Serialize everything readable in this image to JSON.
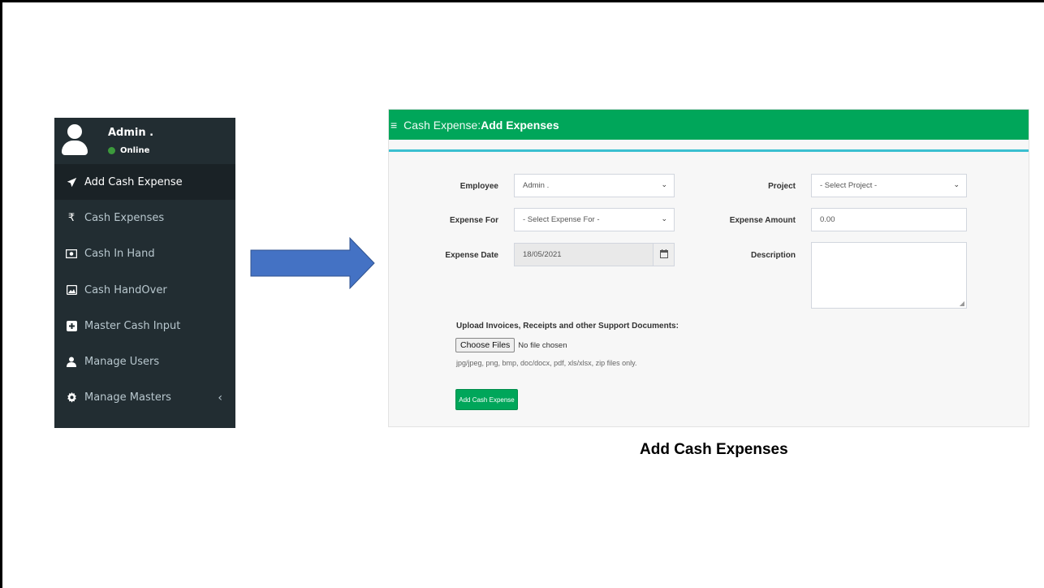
{
  "sidebar": {
    "user_name": "Admin .",
    "user_status": "Online",
    "items": [
      {
        "label": "Add Cash Expense",
        "icon": "paper-plane-icon",
        "active": true
      },
      {
        "label": "Cash Expenses",
        "icon": "rupee-icon"
      },
      {
        "label": "Cash In Hand",
        "icon": "money-icon"
      },
      {
        "label": "Cash HandOver",
        "icon": "image-icon"
      },
      {
        "label": "Master Cash Input",
        "icon": "plus-square-icon"
      },
      {
        "label": "Manage Users",
        "icon": "user-icon"
      },
      {
        "label": "Manage Masters",
        "icon": "gear-icon",
        "has_submenu": true
      }
    ]
  },
  "panel": {
    "header_prefix": "Cash Expense:",
    "header_title": "Add Expenses",
    "header_color": "#00a65a",
    "accent_line_color": "#3bbfd0",
    "employee_label": "Employee",
    "employee_value": "Admin .",
    "project_label": "Project",
    "project_value": "- Select Project -",
    "expense_for_label": "Expense For",
    "expense_for_value": "- Select Expense For -",
    "expense_amount_label": "Expense Amount",
    "expense_amount_value": "0.00",
    "expense_date_label": "Expense Date",
    "expense_date_value": "18/05/2021",
    "description_label": "Description",
    "upload_label": "Upload Invoices, Receipts and other Support Documents:",
    "choose_files_label": "Choose Files",
    "no_file_text": "No file chosen",
    "file_help": "jpg/jpeg, png, bmp, doc/docx, pdf, xls/xlsx, zip files only.",
    "submit_label": "Add Cash Expense"
  },
  "caption": "Add Cash Expenses",
  "colors": {
    "sidebar_bg": "#222d32",
    "arrow_fill": "#4472c4"
  }
}
